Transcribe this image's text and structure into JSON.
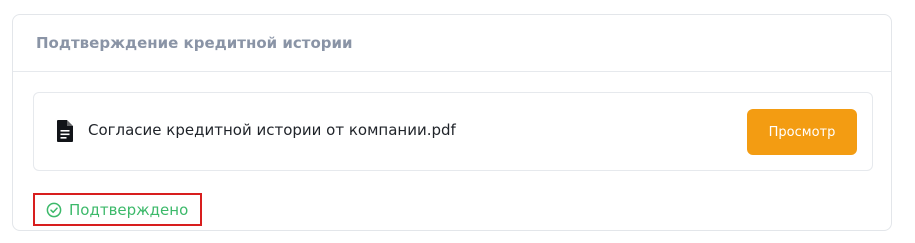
{
  "card": {
    "title": "Подтверждение кредитной истории"
  },
  "document": {
    "file_name": "Согласие кредитной истории от компании.pdf",
    "icon": "file-document-icon",
    "view_button_label": "Просмотр"
  },
  "status": {
    "icon": "check-circle-icon",
    "label": "Подтверждено",
    "color": "#3cb96a"
  },
  "colors": {
    "accent": "#f39c12",
    "highlight_border": "#d81e1e"
  }
}
